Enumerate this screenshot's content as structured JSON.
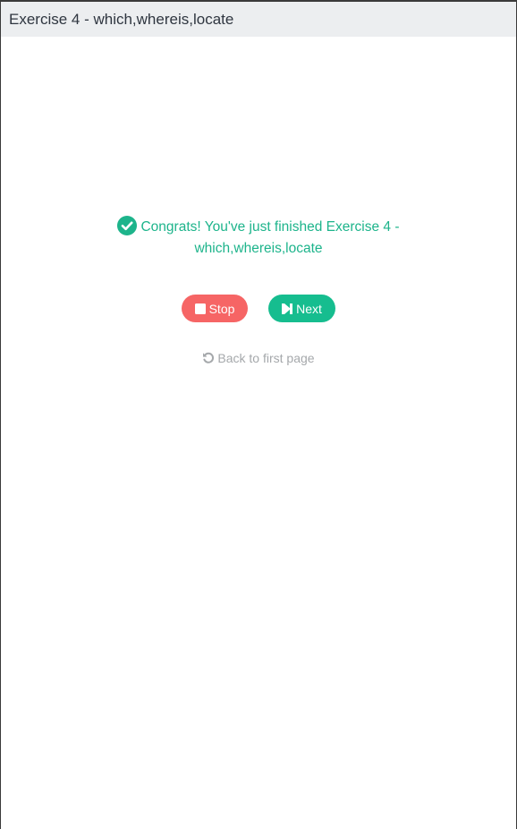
{
  "header": {
    "title": "Exercise 4 - which,whereis,locate"
  },
  "result": {
    "message": "Congrats! You've just finished Exercise 4 - which,whereis,locate",
    "icon": "check-circle-icon",
    "color": "#1db48b"
  },
  "actions": {
    "stop_label": "Stop",
    "stop_icon": "stop-icon",
    "stop_color": "#f66565",
    "next_label": "Next",
    "next_icon": "step-forward-icon",
    "next_color": "#16bd8f"
  },
  "back": {
    "label": "Back to first page",
    "icon": "undo-icon"
  }
}
